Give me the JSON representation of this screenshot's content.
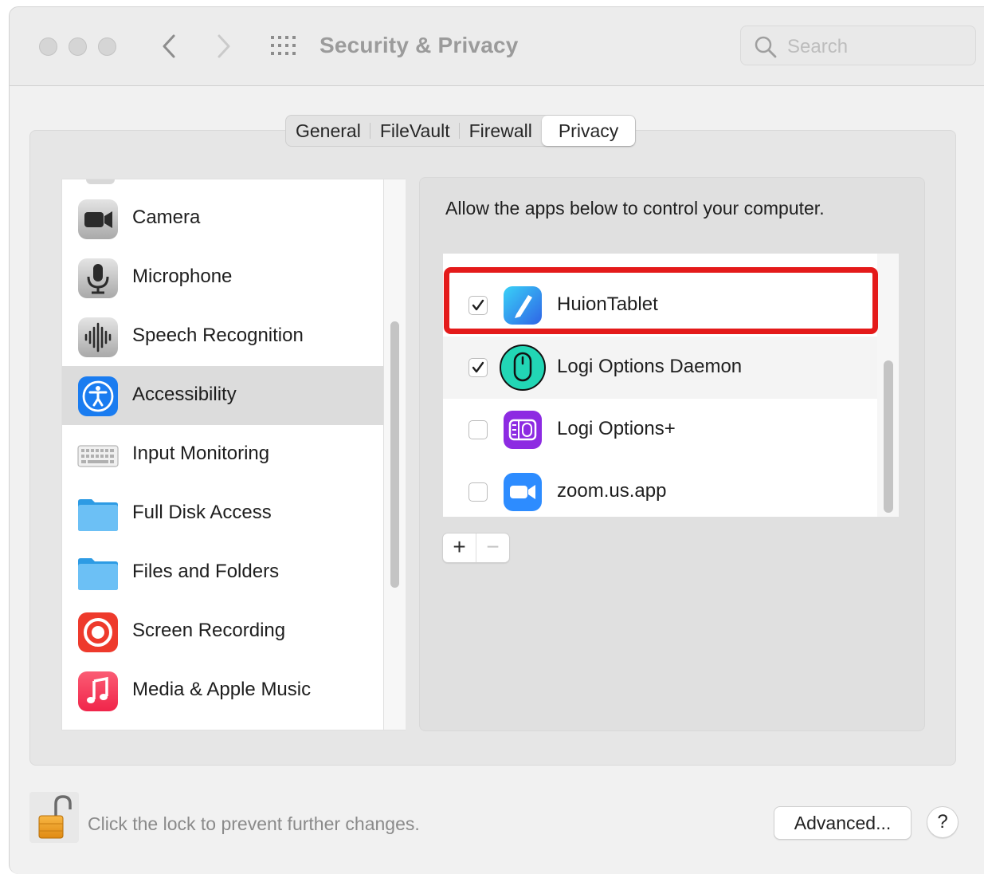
{
  "window": {
    "title": "Security & Privacy"
  },
  "search": {
    "placeholder": "Search"
  },
  "tabs": [
    {
      "label": "General"
    },
    {
      "label": "FileVault"
    },
    {
      "label": "Firewall"
    },
    {
      "label": "Privacy",
      "active": true
    }
  ],
  "sidebar": {
    "items": [
      {
        "label": "Camera",
        "icon": "camera-icon"
      },
      {
        "label": "Microphone",
        "icon": "microphone-icon"
      },
      {
        "label": "Speech Recognition",
        "icon": "waveform-icon"
      },
      {
        "label": "Accessibility",
        "icon": "accessibility-icon",
        "selected": true
      },
      {
        "label": "Input Monitoring",
        "icon": "keyboard-icon"
      },
      {
        "label": "Full Disk Access",
        "icon": "folder-icon"
      },
      {
        "label": "Files and Folders",
        "icon": "folder-icon"
      },
      {
        "label": "Screen Recording",
        "icon": "screen-recording-icon"
      },
      {
        "label": "Media & Apple Music",
        "icon": "music-note-icon"
      }
    ]
  },
  "detail": {
    "description": "Allow the apps below to control your computer.",
    "apps": [
      {
        "name": "HuionTablet",
        "checked": true,
        "icon": "huion-tablet-icon",
        "highlighted": true
      },
      {
        "name": "Logi Options Daemon",
        "checked": true,
        "icon": "logi-mouse-icon"
      },
      {
        "name": "Logi Options+",
        "checked": false,
        "icon": "logi-options-plus-icon"
      },
      {
        "name": "zoom.us.app",
        "checked": false,
        "icon": "zoom-video-icon"
      }
    ],
    "add_label": "+",
    "remove_label": "−"
  },
  "footer": {
    "lock_text": "Click the lock to prevent further changes.",
    "advanced_label": "Advanced...",
    "help_label": "?"
  },
  "colors": {
    "highlight": "#e41a1a",
    "accessibility_blue": "#1a7cf0",
    "selected_row": "#dcdcdc"
  }
}
